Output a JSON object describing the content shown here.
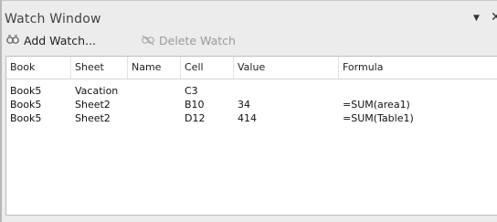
{
  "window": {
    "title": "Watch Window"
  },
  "toolbar": {
    "add_label": "Add Watch...",
    "delete_label": "Delete Watch"
  },
  "table": {
    "columns": [
      "Book",
      "Sheet",
      "Name",
      "Cell",
      "Value",
      "Formula"
    ],
    "rows": [
      {
        "book": "Book5",
        "sheet": "Vacation",
        "name": "",
        "cell": "C3",
        "value": "",
        "formula": ""
      },
      {
        "book": "Book5",
        "sheet": "Sheet2",
        "name": "",
        "cell": "B10",
        "value": "34",
        "formula": "=SUM(area1)"
      },
      {
        "book": "Book5",
        "sheet": "Sheet2",
        "name": "",
        "cell": "D12",
        "value": "414",
        "formula": "=SUM(Table1)"
      }
    ]
  },
  "icons": {
    "add": "add-watch-icon",
    "delete": "delete-watch-icon",
    "menu": "dropdown-arrow-icon",
    "close": "close-icon"
  }
}
